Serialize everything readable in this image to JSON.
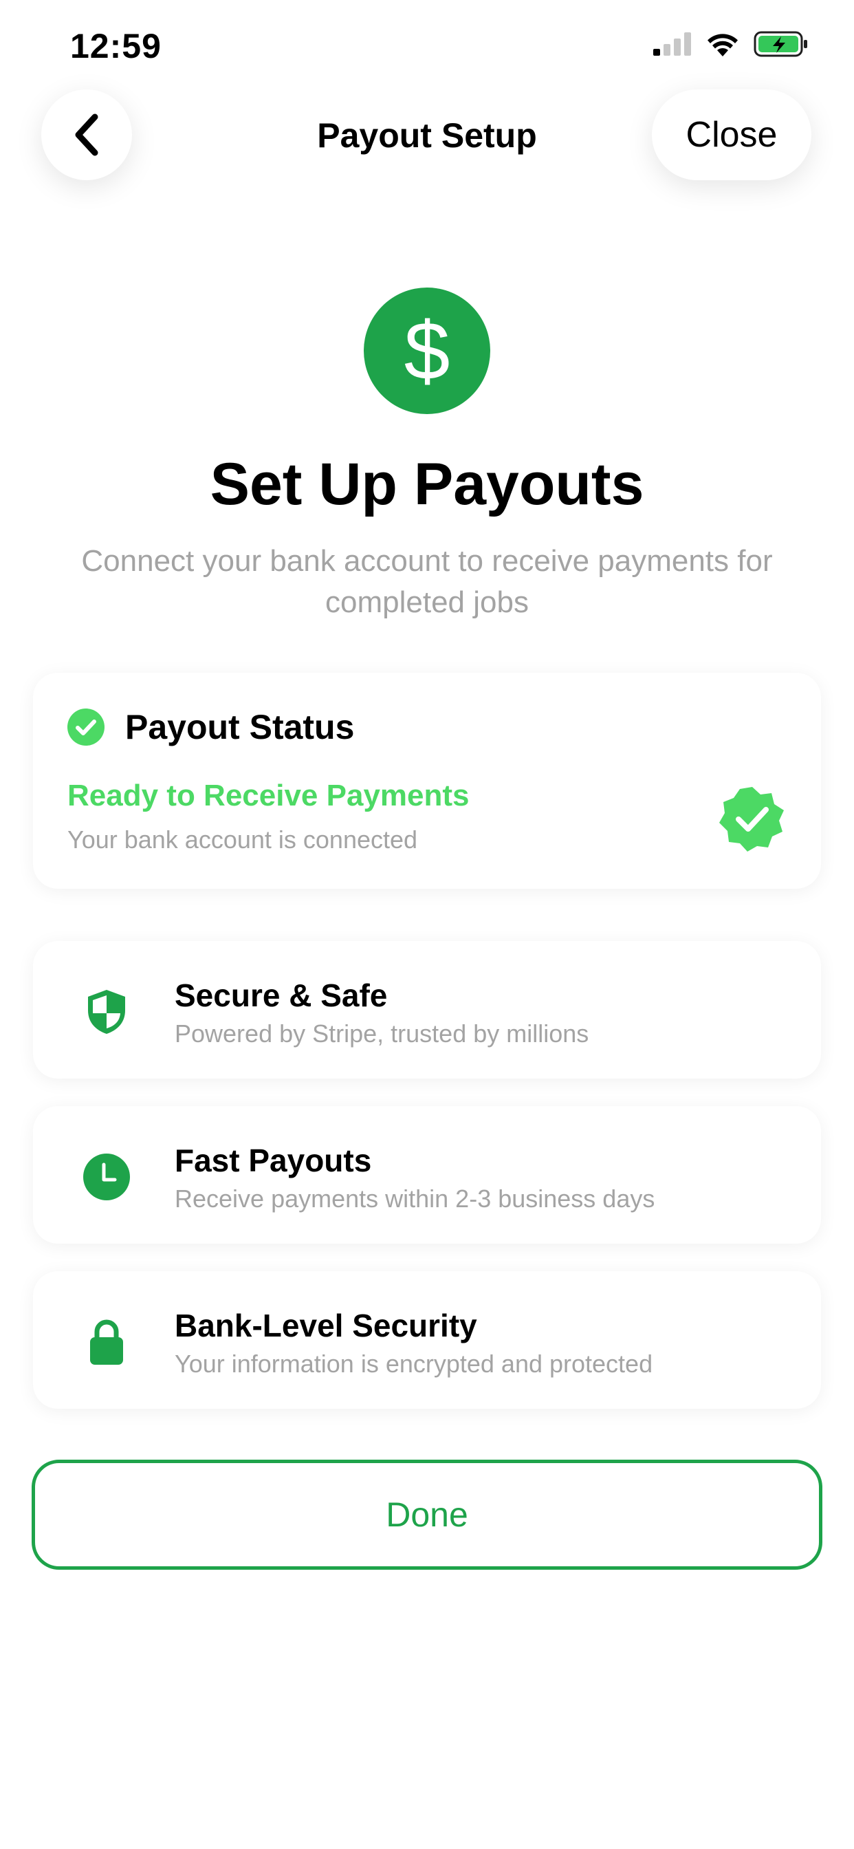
{
  "status_bar": {
    "time": "12:59"
  },
  "nav": {
    "title": "Payout Setup",
    "close_label": "Close"
  },
  "hero": {
    "icon_glyph": "$",
    "title": "Set Up Payouts",
    "subtitle": "Connect your bank account to receive payments for completed jobs"
  },
  "payout_status": {
    "heading": "Payout Status",
    "status_title": "Ready to Receive Payments",
    "status_subtitle": "Your bank account is connected"
  },
  "features": [
    {
      "title": "Secure & Safe",
      "subtitle": "Powered by Stripe, trusted by millions",
      "icon": "shield-icon"
    },
    {
      "title": "Fast Payouts",
      "subtitle": "Receive payments within 2-3 business days",
      "icon": "clock-icon"
    },
    {
      "title": "Bank-Level Security",
      "subtitle": "Your information is encrypted and protected",
      "icon": "lock-icon"
    }
  ],
  "done_label": "Done",
  "colors": {
    "brand_green": "#1ea34a",
    "success_green": "#4cd964",
    "muted_text": "#a3a3a3"
  }
}
